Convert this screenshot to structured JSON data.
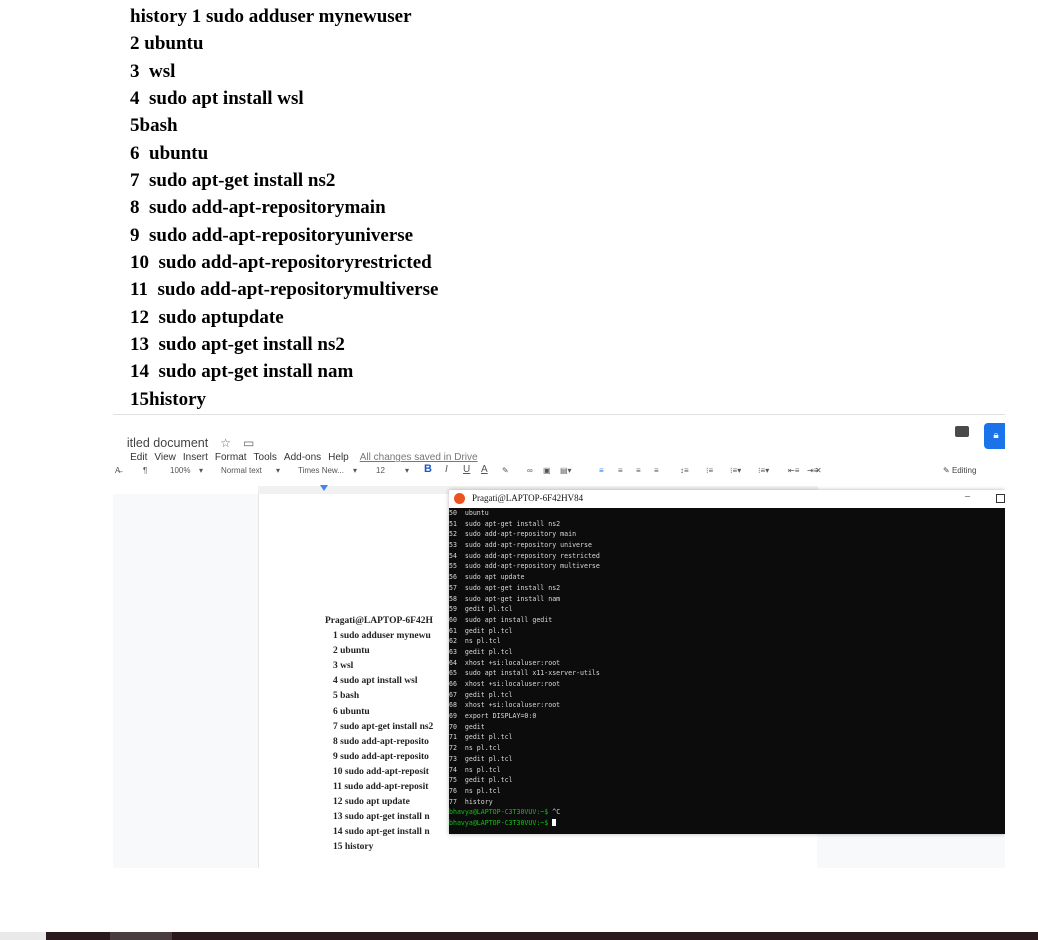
{
  "history_list": [
    "history 1 sudo adduser mynewuser",
    "2 ubuntu",
    "3  wsl",
    "4  sudo apt install wsl",
    "5bash",
    "6  ubuntu",
    "7  sudo apt-get install ns2",
    "8  sudo add-apt-repositorymain",
    "9  sudo add-apt-repositoryuniverse",
    "10  sudo add-apt-repositoryrestricted",
    "11  sudo add-apt-repositorymultiverse",
    "12  sudo aptupdate",
    "13  sudo apt-get install ns2",
    "14  sudo apt-get install nam",
    "15history"
  ],
  "docs": {
    "title": "itled document",
    "menu": [
      "Edit",
      "View",
      "Insert",
      "Format",
      "Tools",
      "Add-ons",
      "Help"
    ],
    "saved_status": "All changes saved in Drive",
    "toolbar": {
      "zoom": "100%",
      "style": "Normal text",
      "font": "Times New...",
      "size": "12",
      "bold": "B",
      "italic": "I",
      "underline": "U",
      "text_color": "A",
      "mode": "Editing"
    },
    "page_text": {
      "header": "Pragati@LAPTOP-6F42H",
      "lines": [
        "1 sudo adduser mynewu",
        "2 ubuntu",
        "3 wsl",
        "4 sudo apt install wsl",
        "5 bash",
        "6 ubuntu",
        "7 sudo apt-get install ns2",
        "8 sudo add-apt-reposito",
        "9 sudo add-apt-reposito",
        "10 sudo add-apt-reposit",
        "11 sudo add-apt-reposit",
        "12 sudo apt update",
        "13 sudo apt-get install n",
        "14 sudo apt-get install n",
        "15 history"
      ]
    }
  },
  "terminal": {
    "title": "Pragati@LAPTOP-6F42HV84",
    "minimize": "–",
    "lines": [
      "50  ubuntu",
      "51  sudo apt-get install ns2",
      "52  sudo add-apt-repository main",
      "53  sudo add-apt-repository universe",
      "54  sudo add-apt-repository restricted",
      "55  sudo add-apt-repository multiverse",
      "56  sudo apt update",
      "57  sudo apt-get install ns2",
      "58  sudo apt-get install nam",
      "59  gedit pl.tcl",
      "60  sudo apt install gedit",
      "61  gedit pl.tcl",
      "62  ns pl.tcl",
      "63  gedit pl.tcl",
      "64  xhost +si:localuser:root",
      "65  sudo apt install x11-xserver-utils",
      "66  xhost +si:localuser:root",
      "67  gedit pl.tcl",
      "68  xhost +si:localuser:root",
      "69  export DISPLAY=0:0",
      "70  gedit",
      "71  gedit pl.tcl",
      "72  ns pl.tcl",
      "73  gedit pl.tcl",
      "74  ns pl.tcl",
      "75  gedit pl.tcl",
      "76  ns pl.tcl",
      "77  history"
    ],
    "prompt_lines": [
      {
        "prompt": "bhavya@LAPTOP-C3T30VUV:~$",
        "cmd": " ^C"
      },
      {
        "prompt": "bhavya@LAPTOP-C3T30VUV:~$",
        "cmd": " "
      }
    ]
  },
  "colors": {
    "terminal_bg": "#0c0c0c",
    "prompt_green": "#13c013",
    "share_blue": "#1a73e8",
    "ubuntu_orange": "#e95420"
  }
}
